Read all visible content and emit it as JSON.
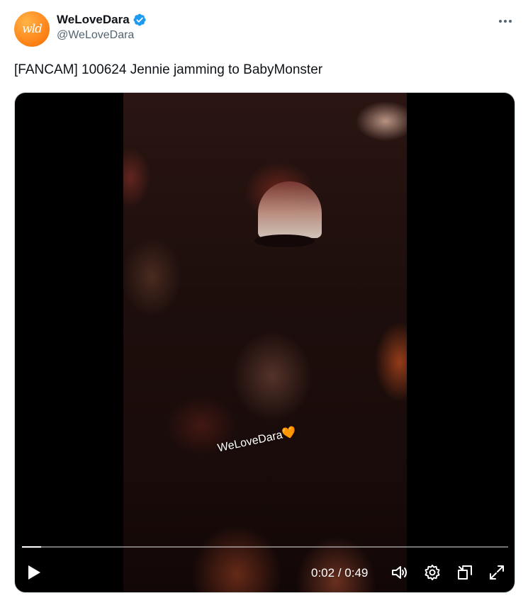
{
  "author": {
    "display_name": "WeLoveDara",
    "handle": "@WeLoveDara",
    "avatar_text": "wld",
    "avatar_color": "#ff8a1f",
    "verified_icon": "verified-badge-icon",
    "verified_color": "#1d9bf0"
  },
  "tweet": {
    "text": "[FANCAM] 100624 Jennie jamming to BabyMonster"
  },
  "video": {
    "watermark": "WeLoveDara🧡",
    "current_time": "0:02",
    "duration": "0:49",
    "time_separator": "/",
    "progress_fraction": 0.04,
    "controls": [
      "play-icon",
      "volume-icon",
      "settings-gear-icon",
      "picture-in-picture-icon",
      "fullscreen-icon"
    ]
  }
}
